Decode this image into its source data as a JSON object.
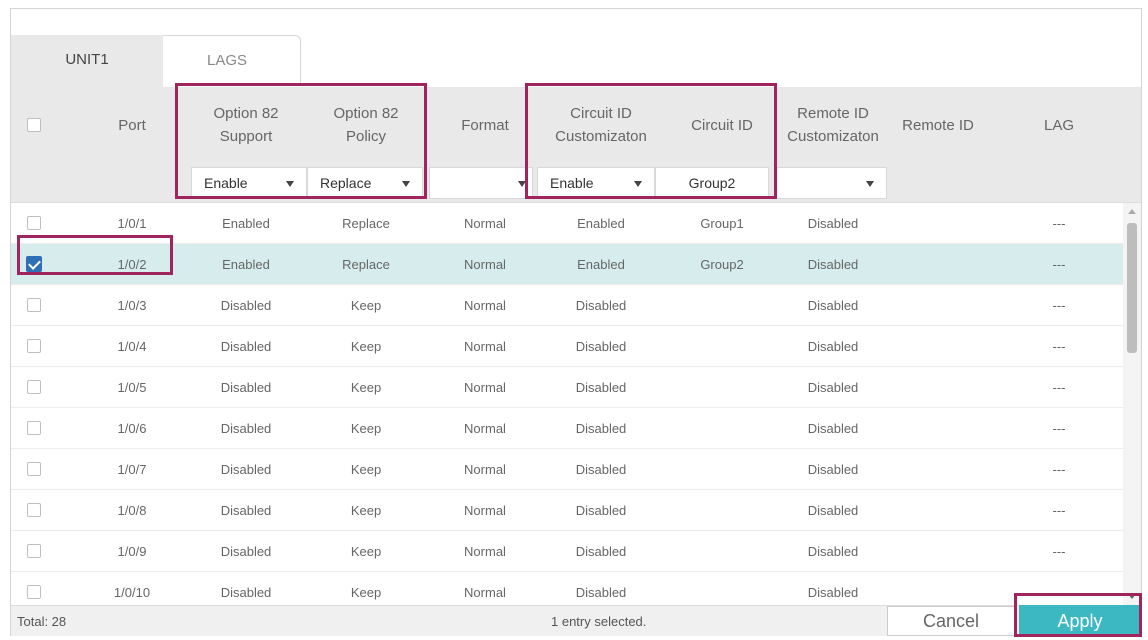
{
  "tabs": [
    {
      "label": "UNIT1",
      "active": true
    },
    {
      "label": "LAGS",
      "active": false
    }
  ],
  "columns": {
    "port": "Port",
    "opt82_support": "Option 82\nSupport",
    "opt82_policy": "Option 82\nPolicy",
    "format": "Format",
    "circuit_custom": "Circuit ID\nCustomizaton",
    "circuit_id": "Circuit ID",
    "remote_custom": "Remote ID\nCustomizaton",
    "remote_id": "Remote ID",
    "lag": "LAG"
  },
  "filters": {
    "opt82_support": "Enable",
    "opt82_policy": "Replace",
    "format": "",
    "circuit_custom": "Enable",
    "circuit_id": "Group2",
    "remote_custom": ""
  },
  "rows": [
    {
      "port": "1/0/1",
      "support": "Enabled",
      "policy": "Replace",
      "format": "Normal",
      "circuit_custom": "Enabled",
      "circuit_id": "Group1",
      "remote_custom": "Disabled",
      "remote_id": "",
      "lag": "---",
      "checked": false
    },
    {
      "port": "1/0/2",
      "support": "Enabled",
      "policy": "Replace",
      "format": "Normal",
      "circuit_custom": "Enabled",
      "circuit_id": "Group2",
      "remote_custom": "Disabled",
      "remote_id": "",
      "lag": "---",
      "checked": true
    },
    {
      "port": "1/0/3",
      "support": "Disabled",
      "policy": "Keep",
      "format": "Normal",
      "circuit_custom": "Disabled",
      "circuit_id": "",
      "remote_custom": "Disabled",
      "remote_id": "",
      "lag": "---",
      "checked": false
    },
    {
      "port": "1/0/4",
      "support": "Disabled",
      "policy": "Keep",
      "format": "Normal",
      "circuit_custom": "Disabled",
      "circuit_id": "",
      "remote_custom": "Disabled",
      "remote_id": "",
      "lag": "---",
      "checked": false
    },
    {
      "port": "1/0/5",
      "support": "Disabled",
      "policy": "Keep",
      "format": "Normal",
      "circuit_custom": "Disabled",
      "circuit_id": "",
      "remote_custom": "Disabled",
      "remote_id": "",
      "lag": "---",
      "checked": false
    },
    {
      "port": "1/0/6",
      "support": "Disabled",
      "policy": "Keep",
      "format": "Normal",
      "circuit_custom": "Disabled",
      "circuit_id": "",
      "remote_custom": "Disabled",
      "remote_id": "",
      "lag": "---",
      "checked": false
    },
    {
      "port": "1/0/7",
      "support": "Disabled",
      "policy": "Keep",
      "format": "Normal",
      "circuit_custom": "Disabled",
      "circuit_id": "",
      "remote_custom": "Disabled",
      "remote_id": "",
      "lag": "---",
      "checked": false
    },
    {
      "port": "1/0/8",
      "support": "Disabled",
      "policy": "Keep",
      "format": "Normal",
      "circuit_custom": "Disabled",
      "circuit_id": "",
      "remote_custom": "Disabled",
      "remote_id": "",
      "lag": "---",
      "checked": false
    },
    {
      "port": "1/0/9",
      "support": "Disabled",
      "policy": "Keep",
      "format": "Normal",
      "circuit_custom": "Disabled",
      "circuit_id": "",
      "remote_custom": "Disabled",
      "remote_id": "",
      "lag": "---",
      "checked": false
    },
    {
      "port": "1/0/10",
      "support": "Disabled",
      "policy": "Keep",
      "format": "Normal",
      "circuit_custom": "Disabled",
      "circuit_id": "",
      "remote_custom": "Disabled",
      "remote_id": "",
      "lag": "---",
      "checked": false
    }
  ],
  "footer": {
    "total": "Total: 28",
    "selected": "1 entry selected.",
    "cancel": "Cancel",
    "apply": "Apply"
  },
  "colors": {
    "highlight": "#a0245e",
    "selected_row": "#d7eced",
    "apply": "#3cb8c2",
    "checkbox_checked": "#2f6fb5"
  }
}
